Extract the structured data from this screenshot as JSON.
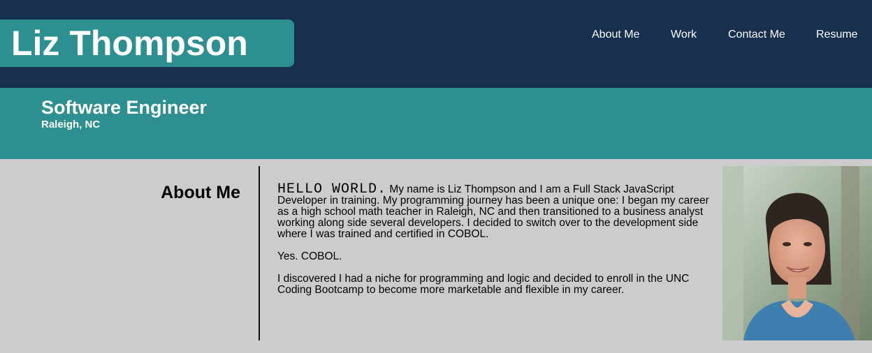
{
  "header": {
    "name": "Liz Thompson",
    "nav": [
      "About Me",
      "Work",
      "Contact Me",
      "Resume"
    ]
  },
  "banner": {
    "role": "Software Engineer",
    "location": "Raleigh, NC"
  },
  "about": {
    "title": "About Me",
    "greeting": "HELLO WORLD.",
    "intro": " My name is Liz Thompson and I am a Full Stack JavaScript Developer in training. My programming journey has been a unique one: I began my career as a high school math teacher in Raleigh, NC and then transitioned to a business analyst working along side several developers. I decided to switch over to the development side where I was trained and certified in COBOL.",
    "p2": "Yes. COBOL.",
    "p3": "I discovered I had a niche for programming and logic and decided to enroll in the UNC Coding Bootcamp to become more marketable and flexible in my career."
  },
  "colors": {
    "header_bg": "#17304f",
    "teal": "#2d8f8f",
    "main_bg": "#cccccc"
  }
}
